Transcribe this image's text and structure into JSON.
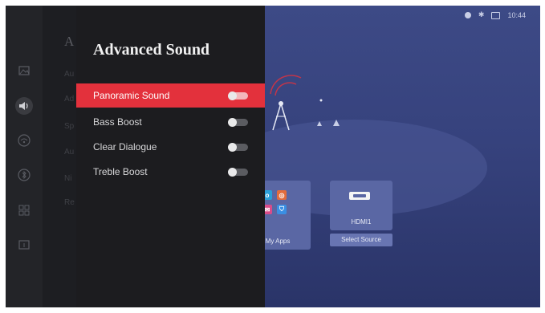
{
  "status": {
    "time": "10:44",
    "bluetooth": "✱"
  },
  "sidebar": {
    "icons": [
      "picture-icon",
      "sound-icon",
      "network-icon",
      "bluetooth-icon",
      "apps-icon",
      "info-icon"
    ],
    "active_index": 1,
    "ghost_title": "A",
    "ghost_items": [
      "Au",
      "Ad",
      "Sp",
      "Au",
      "Ni",
      "Re"
    ]
  },
  "overlay": {
    "title": "Advanced Sound",
    "options": [
      {
        "label": "Panoramic Sound",
        "on": false
      },
      {
        "label": "Bass Boost",
        "on": false
      },
      {
        "label": "Clear Dialogue",
        "on": false
      },
      {
        "label": "Treble Boost",
        "on": false
      }
    ],
    "selected_index": 0
  },
  "home": {
    "apps_label": "My Apps",
    "hdmi_label": "HDMI1",
    "source_button": "Select Source"
  },
  "colors": {
    "accent": "#e3313c",
    "panel": "#1c1c1f",
    "background": "#36427d"
  }
}
